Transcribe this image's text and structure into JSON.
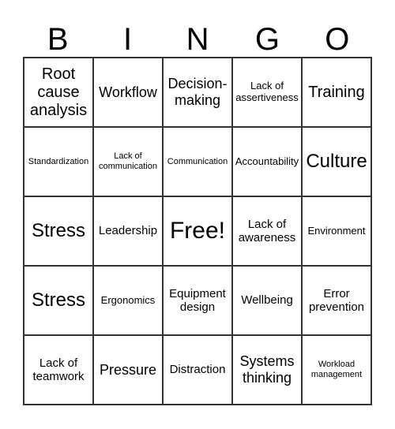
{
  "header": [
    "B",
    "I",
    "N",
    "G",
    "O"
  ],
  "cells": [
    "Root cause analysis",
    "Workflow",
    "Decision-making",
    "Lack of assertiveness",
    "Training",
    "Standardization",
    "Lack of communication",
    "Communication",
    "Accountability",
    "Culture",
    "Stress",
    "Leadership",
    "Free!",
    "Lack of awareness",
    "Environment",
    "Stress",
    "Ergonomics",
    "Equipment design",
    "Wellbeing",
    "Error prevention",
    "Lack of teamwork",
    "Pressure",
    "Distraction",
    "Systems thinking",
    "Workload management"
  ]
}
